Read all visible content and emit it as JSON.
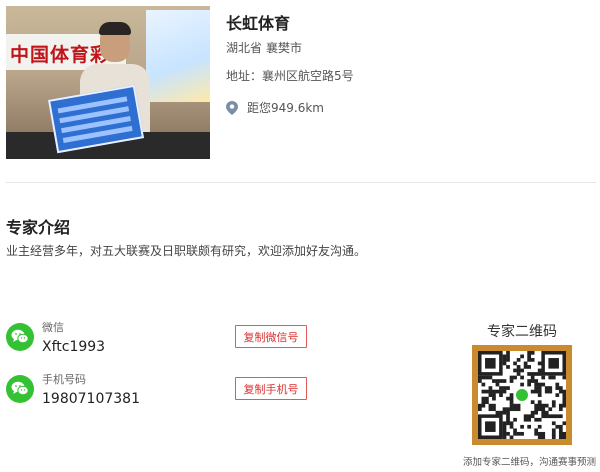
{
  "store": {
    "name": "长虹体育",
    "province": "湖北省",
    "city": "襄樊市",
    "address": "地址：襄州区航空路5号",
    "distance": "距您949.6km",
    "photo_banner_text": "中国体育彩"
  },
  "intro": {
    "title": "专家介绍",
    "text": "业主经营多年，对五大联赛及日职联颇有研究，欢迎添加好友沟通。"
  },
  "contacts": {
    "wechat": {
      "label": "微信",
      "value": "Xftc1993",
      "copy_label": "复制微信号",
      "icon": "wechat-icon"
    },
    "phone": {
      "label": "手机号码",
      "value": "19807107381",
      "copy_label": "复制手机号",
      "icon": "wechat-icon"
    }
  },
  "qr": {
    "title": "专家二维码",
    "caption": "添加专家二维码，沟通赛事预测",
    "frame_color": "#c98b2e"
  },
  "colors": {
    "accent_red": "#d93030",
    "wechat_green": "#34c234",
    "pin_gray": "#7b8ea6"
  }
}
